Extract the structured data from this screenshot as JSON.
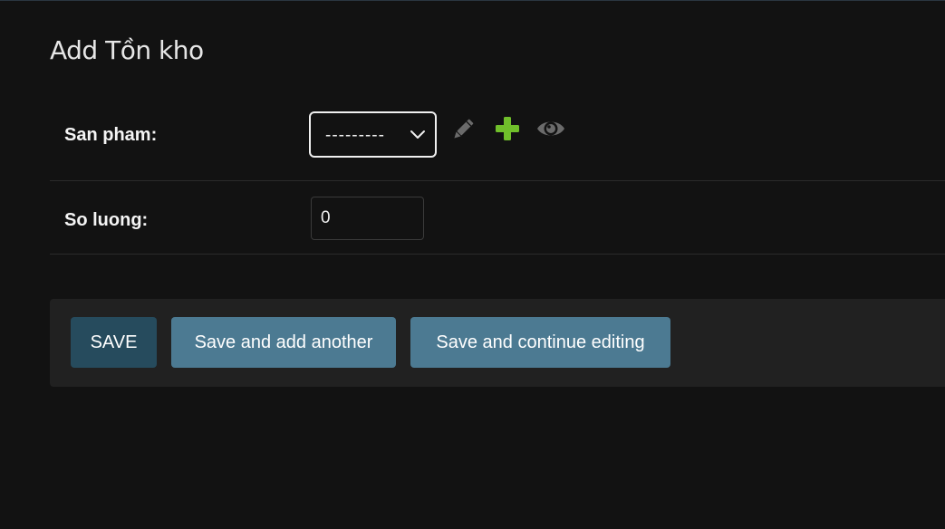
{
  "page": {
    "title": "Add Tồn kho"
  },
  "form": {
    "product": {
      "label": "San pham:",
      "selected": "---------",
      "icons": [
        "pencil-icon",
        "plus-icon",
        "eye-icon"
      ]
    },
    "quantity": {
      "label": "So luong:",
      "value": "0"
    }
  },
  "actions": {
    "save_label": "SAVE",
    "save_add_another_label": "Save and add another",
    "save_continue_label": "Save and continue editing"
  },
  "colors": {
    "background": "#121212",
    "submit_row": "#212121",
    "save_button": "#264b5d",
    "secondary_button": "#4c7a92",
    "plus_icon": "#70bf2b",
    "muted_icon": "#6b6b6b"
  }
}
